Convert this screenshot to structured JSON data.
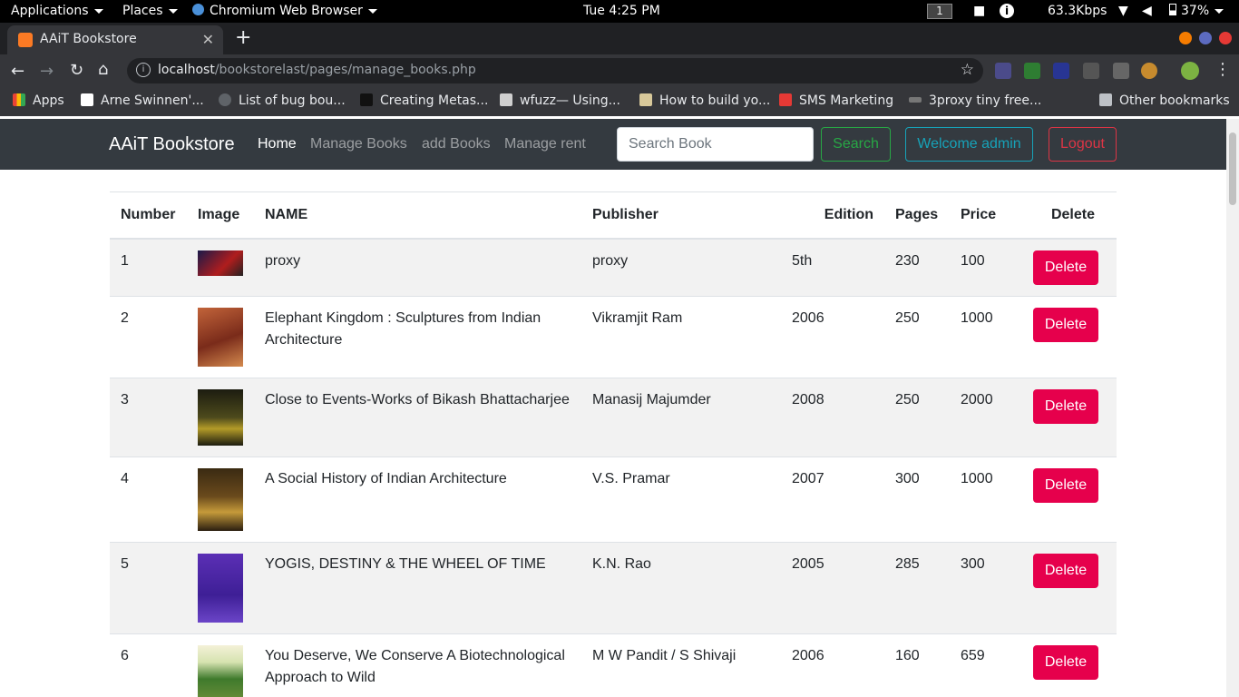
{
  "system_bar": {
    "applications": "Applications",
    "places": "Places",
    "browser_app": "Chromium Web Browser",
    "clock": "Tue  4:25 PM",
    "workspace": "1",
    "network_speed": "63.3Kbps",
    "battery": "37%"
  },
  "browser": {
    "tab_title": "AAiT Bookstore",
    "url_host": "localhost",
    "url_path": "/bookstorelast/pages/manage_books.php",
    "bookmarks": [
      "Apps",
      "Arne Swinnen'...",
      "List of bug bou...",
      "Creating Metas...",
      "wfuzz— Using...",
      "How to build yo...",
      "SMS Marketing",
      "3proxy tiny free...",
      "Other bookmarks"
    ]
  },
  "page": {
    "brand": "AAiT Bookstore",
    "nav": [
      "Home",
      "Manage Books",
      "add Books",
      "Manage rent"
    ],
    "search_placeholder": "Search Book",
    "search_button": "Search",
    "welcome": "Welcome admin",
    "logout": "Logout",
    "table": {
      "headers": [
        "Number",
        "Image",
        "NAME",
        "Publisher",
        "Edition",
        "Pages",
        "Price",
        "Delete"
      ],
      "delete_label": "Delete",
      "rows": [
        {
          "number": "1",
          "name": "proxy",
          "publisher": "proxy",
          "edition": "5th",
          "pages": "230",
          "price": "100"
        },
        {
          "number": "2",
          "name": "Elephant Kingdom : Sculptures from Indian Architecture",
          "publisher": "Vikramjit Ram",
          "edition": "2006",
          "pages": "250",
          "price": "1000"
        },
        {
          "number": "3",
          "name": "Close to Events-Works of Bikash Bhattacharjee",
          "publisher": "Manasij Majumder",
          "edition": "2008",
          "pages": "250",
          "price": "2000"
        },
        {
          "number": "4",
          "name": "A Social History of Indian Architecture",
          "publisher": "V.S. Pramar",
          "edition": "2007",
          "pages": "300",
          "price": "1000"
        },
        {
          "number": "5",
          "name": "YOGIS, DESTINY & THE WHEEL OF TIME",
          "publisher": "K.N. Rao",
          "edition": "2005",
          "pages": "285",
          "price": "300"
        },
        {
          "number": "6",
          "name": "You Deserve, We Conserve A Biotechnological Approach to Wild",
          "publisher": "M W Pandit / S Shivaji",
          "edition": "2006",
          "pages": "160",
          "price": "659"
        }
      ]
    }
  },
  "colors": {
    "navbar_bg": "#343a40",
    "delete_bg": "#e6004c",
    "search_btn": "#28a745",
    "welcome_btn": "#17a2b8",
    "logout_btn": "#dc3545"
  }
}
